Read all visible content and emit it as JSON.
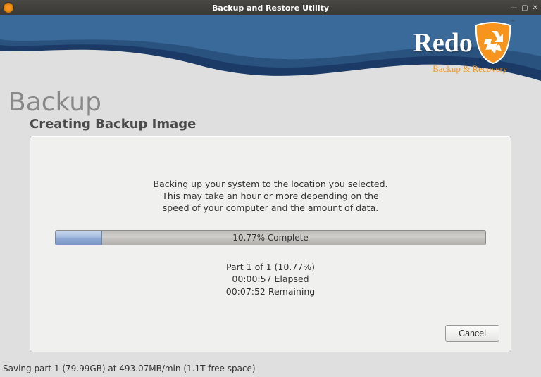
{
  "titlebar": {
    "title": "Backup and Restore Utility"
  },
  "logo": {
    "word": "Redo",
    "tagline": "Backup & Recovery"
  },
  "page": {
    "heading": "Backup",
    "subheading": "Creating Backup Image",
    "message_line1": "Backing up your system to the location you selected.",
    "message_line2": "This may take an hour or more depending on the",
    "message_line3": "speed of your computer and the amount of data."
  },
  "progress": {
    "percent": 10.77,
    "label": "10.77% Complete",
    "part_line": "Part 1 of 1 (10.77%)",
    "elapsed": "00:00:57 Elapsed",
    "remaining": "00:07:52 Remaining"
  },
  "buttons": {
    "cancel": "Cancel"
  },
  "status": "Saving part 1 (79.99GB) at 493.07MB/min (1.1T free space)"
}
